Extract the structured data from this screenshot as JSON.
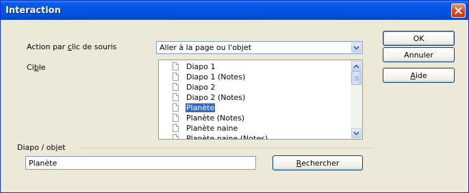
{
  "window": {
    "title": "Interaction"
  },
  "action": {
    "label_pre": "Action par ",
    "label_key": "c",
    "label_post": "lic de souris",
    "value": "Aller à la page ou l'objet"
  },
  "target": {
    "label_pre": "Ci",
    "label_key": "b",
    "label_post": "le",
    "items": [
      {
        "label": "Diapo 1",
        "selected": false
      },
      {
        "label": "Diapo 1 (Notes)",
        "selected": false
      },
      {
        "label": "Diapo 2",
        "selected": false
      },
      {
        "label": "Diapo 2 (Notes)",
        "selected": false
      },
      {
        "label": "Planète",
        "selected": true
      },
      {
        "label": "Planète (Notes)",
        "selected": false
      },
      {
        "label": "Planète naine",
        "selected": false
      },
      {
        "label": "Planète naine (Notes)",
        "selected": false
      }
    ]
  },
  "object": {
    "section_label": "Diapo / objet",
    "value": "Planète",
    "search_pre": "",
    "search_key": "R",
    "search_post": "echercher"
  },
  "buttons": {
    "ok": "OK",
    "cancel": "Annuler",
    "help_pre": "",
    "help_key": "A",
    "help_post": "ide"
  },
  "icons": {
    "close": "close-icon",
    "combo_arrow": "chevron-down-icon",
    "scroll_up": "scroll-up-arrow-icon",
    "scroll_down": "scroll-down-arrow-icon",
    "tree_item": "document-icon"
  },
  "colors": {
    "titlebar": "#0554E3",
    "dialog_bg": "#ECE9D8",
    "selection": "#316AC5",
    "close_button": "#D2451F"
  }
}
